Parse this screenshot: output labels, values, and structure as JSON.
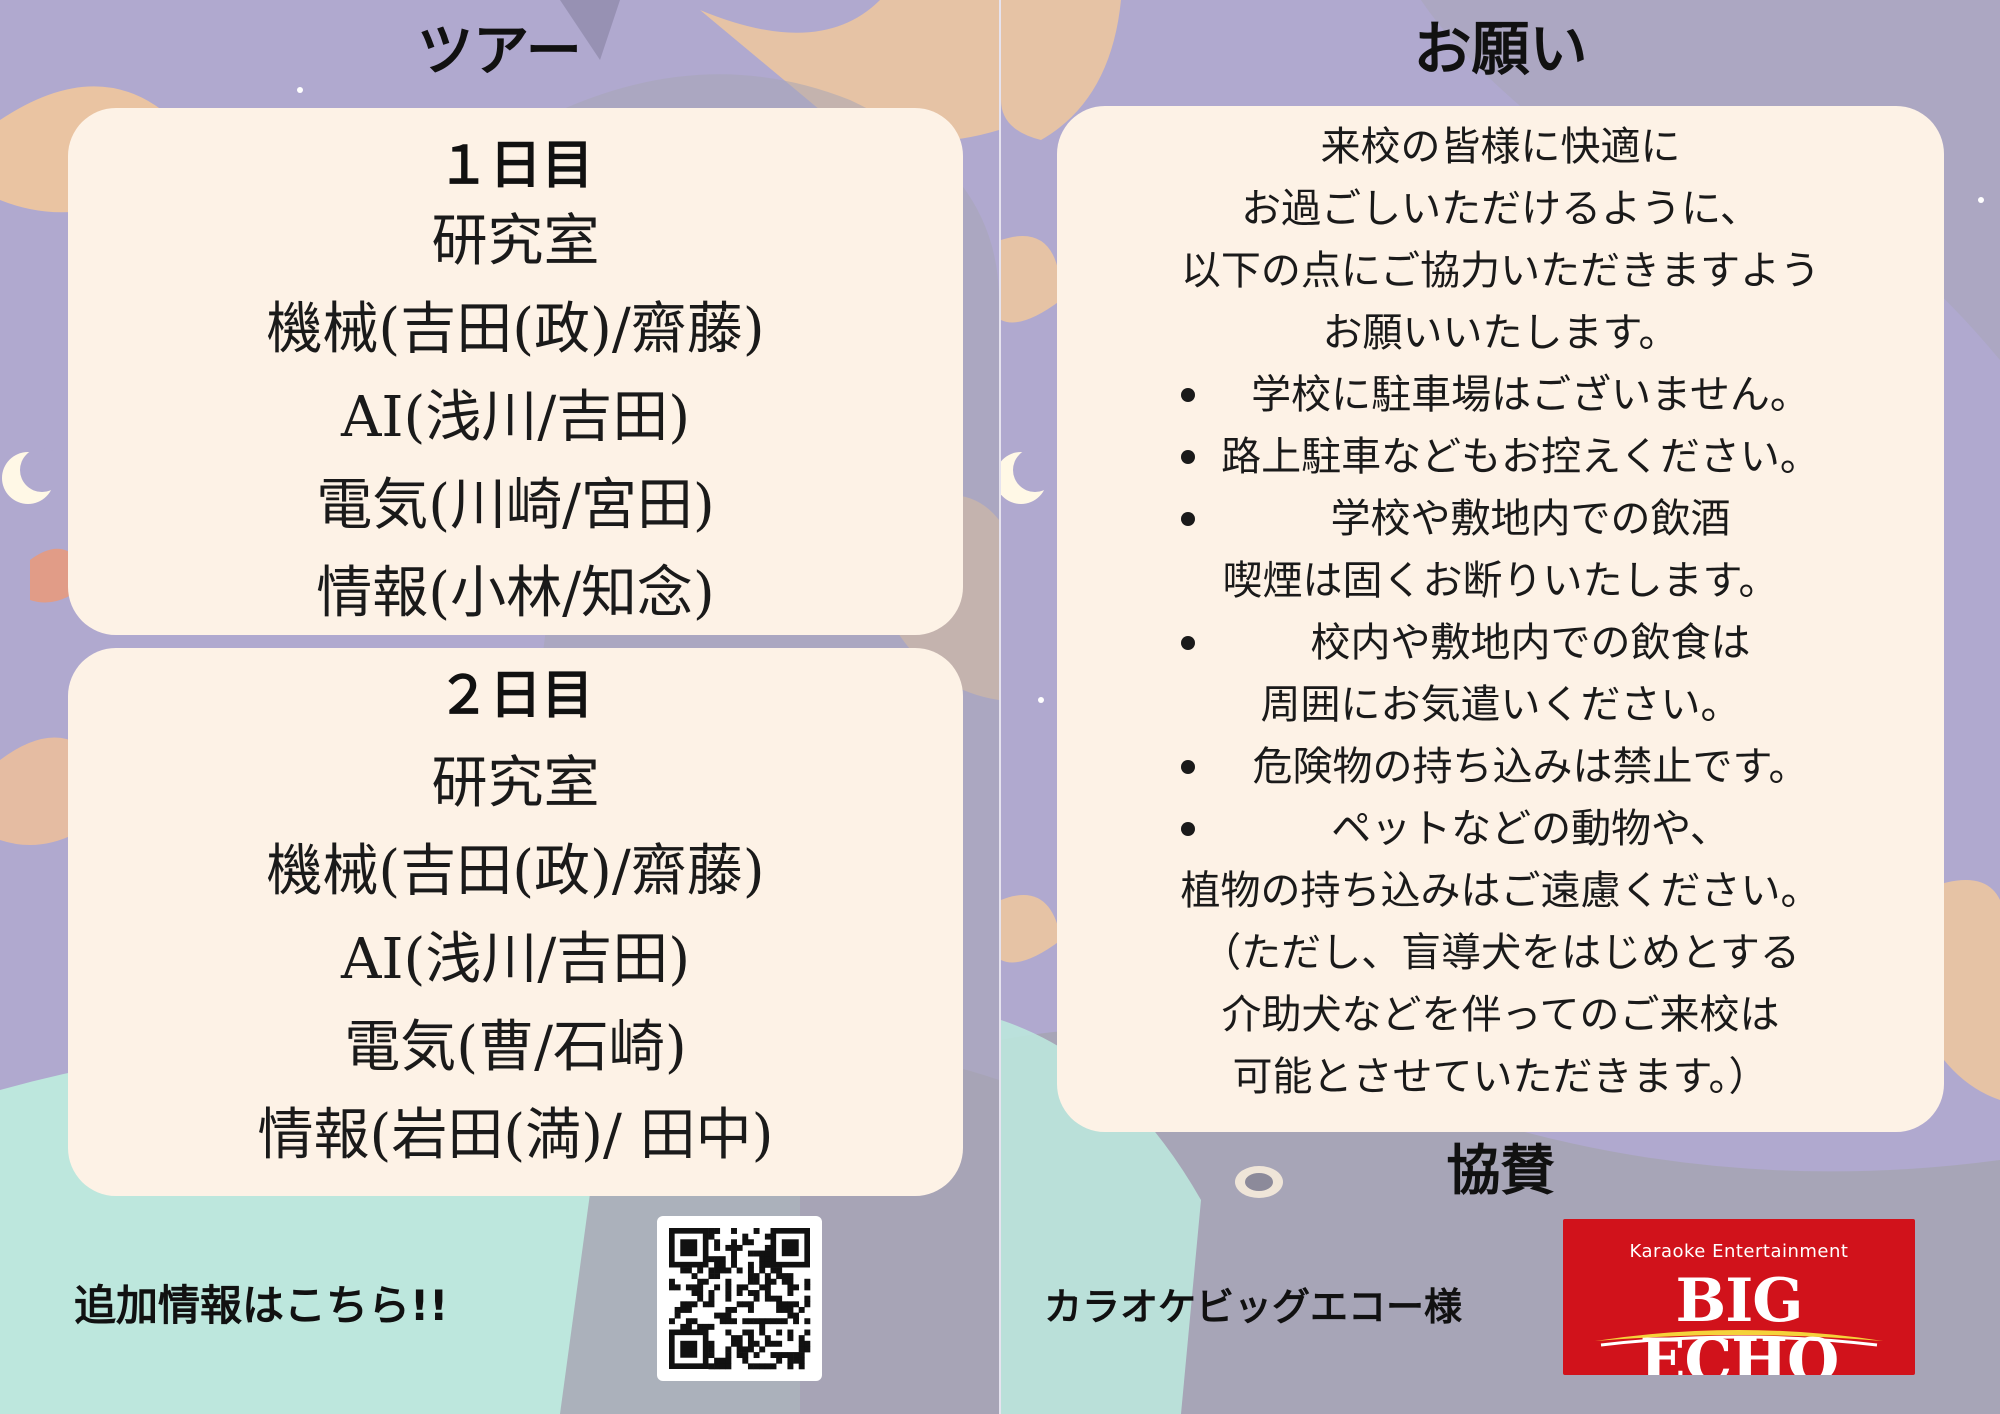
{
  "left": {
    "heading": "ツアー",
    "day1": {
      "title": "１日目",
      "items": [
        "研究室",
        "機械(吉田(政)/齋藤)",
        "AI(浅川/吉田)",
        "電気(川崎/宮田)",
        "情報(小林/知念)"
      ]
    },
    "day2": {
      "title": "２日目",
      "items": [
        "研究室",
        "機械(吉田(政)/齋藤)",
        "AI(浅川/吉田)",
        "電気(曹/石崎)",
        "情報(岩田(満)/ 田中)"
      ]
    },
    "footer_text": "追加情報はこちら!!",
    "qr_icon": "qr-code-icon"
  },
  "right": {
    "heading": "お願い",
    "intro_lines": [
      "来校の皆様に快適に",
      "お過ごしいただけるように、",
      "以下の点にご協力いただきますよう",
      "お願いいたします。"
    ],
    "rules": [
      {
        "lines": [
          "学校に駐車場はございません。"
        ]
      },
      {
        "lines": [
          "路上駐車などもお控えください。"
        ]
      },
      {
        "lines": [
          "学校や敷地内での飲酒",
          "喫煙は固くお断りいたします。"
        ]
      },
      {
        "lines": [
          "校内や敷地内での飲食は",
          "周囲にお気遣いください。"
        ]
      },
      {
        "lines": [
          "危険物の持ち込みは禁止です。"
        ]
      },
      {
        "lines": [
          "ペットなどの動物や、",
          "植物の持ち込みはご遠慮ください。"
        ]
      }
    ],
    "note_lines": [
      "（ただし、盲導犬をはじめとする",
      "介助犬などを伴ってのご来校は",
      "可能とさせていただきます。）"
    ],
    "sponsor_heading": "協賛",
    "sponsor_name": "カラオケビッグエコー様",
    "logo": {
      "subtitle": "Karaoke Entertainment",
      "name": "BIG ECHO",
      "color": "#d1121b"
    }
  },
  "colors": {
    "card": "#fdf2e6",
    "background": "#b0a9cf"
  }
}
